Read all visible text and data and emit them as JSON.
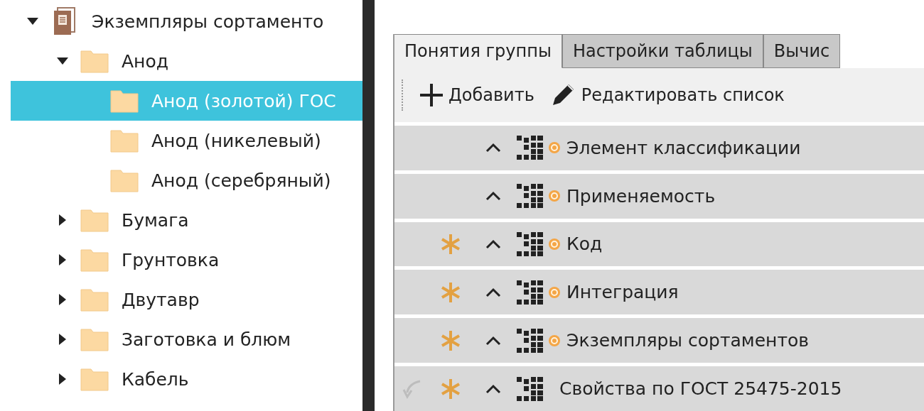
{
  "tree": [
    {
      "label": "Экземпляры сортаменто",
      "kind": "document",
      "expanded": true,
      "selected": false,
      "children": [
        {
          "label": "Анод",
          "kind": "folder",
          "expanded": true,
          "selected": false,
          "children": [
            {
              "label": "Анод (золотой) ГОС",
              "kind": "folder",
              "selected": true
            },
            {
              "label": "Анод (никелевый)",
              "kind": "folder",
              "selected": false
            },
            {
              "label": "Анод (серебряный)",
              "kind": "folder",
              "selected": false
            }
          ]
        },
        {
          "label": "Бумага",
          "kind": "folder",
          "expanded": false,
          "selected": false
        },
        {
          "label": "Грунтовка",
          "kind": "folder",
          "expanded": false,
          "selected": false
        },
        {
          "label": "Двутавр",
          "kind": "folder",
          "expanded": false,
          "selected": false
        },
        {
          "label": "Заготовка и блюм",
          "kind": "folder",
          "expanded": false,
          "selected": false
        },
        {
          "label": "Кабель",
          "kind": "folder",
          "expanded": false,
          "selected": false
        }
      ]
    }
  ],
  "tabs": [
    {
      "label": "Понятия группы",
      "selected": true
    },
    {
      "label": "Настройки таблицы",
      "selected": false
    },
    {
      "label": "Вычис",
      "selected": false
    }
  ],
  "toolbar": [
    {
      "kind": "add",
      "label": "Добавить"
    },
    {
      "kind": "edit",
      "label": "Редактировать список"
    }
  ],
  "rows": [
    {
      "label": "Элемент классификации",
      "linked": false,
      "required": false,
      "badge": true
    },
    {
      "label": "Применяемость",
      "linked": false,
      "required": false,
      "badge": true
    },
    {
      "label": "Код",
      "linked": false,
      "required": true,
      "badge": true
    },
    {
      "label": "Интеграция",
      "linked": false,
      "required": true,
      "badge": true
    },
    {
      "label": "Экземпляры сортаментов",
      "linked": false,
      "required": true,
      "badge": true
    },
    {
      "label": "Свойства по ГОСТ 25475-2015",
      "linked": true,
      "required": true,
      "badge": false
    }
  ]
}
